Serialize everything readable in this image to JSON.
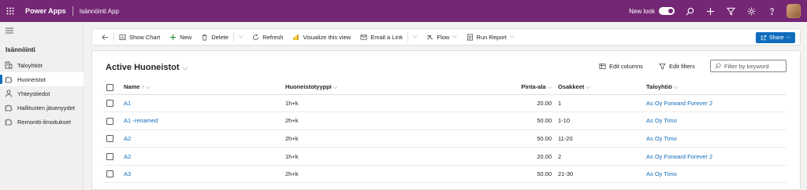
{
  "header": {
    "brand": "Power Apps",
    "app_name": "Isännöinti App",
    "new_look_label": "New look"
  },
  "sidebar": {
    "section_title": "Isännöinti",
    "items": [
      {
        "label": "Taloyhtiöt",
        "icon": "building-icon",
        "active": false
      },
      {
        "label": "Huoneistot",
        "icon": "puzzle-icon",
        "active": true
      },
      {
        "label": "Yhteystiedot",
        "icon": "person-icon",
        "active": false
      },
      {
        "label": "Hallitusten jäsenyydet",
        "icon": "puzzle-icon",
        "active": false
      },
      {
        "label": "Remontti-ilmoitukset",
        "icon": "puzzle-icon",
        "active": false
      }
    ]
  },
  "commandbar": {
    "show_chart": "Show Chart",
    "new": "New",
    "delete": "Delete",
    "refresh": "Refresh",
    "visualize": "Visualize this view",
    "email_link": "Email a Link",
    "flow": "Flow",
    "run_report": "Run Report",
    "share": "Share"
  },
  "view": {
    "title": "Active Huoneistot",
    "edit_columns": "Edit columns",
    "edit_filters": "Edit filters",
    "search_placeholder": "Filter by keyword"
  },
  "grid": {
    "columns": {
      "name": "Name",
      "name_sort": "↑",
      "type": "Huoneistotyyppi",
      "area": "Pinta-ala",
      "shares": "Osakkeet",
      "company": "Taloyhtiö"
    },
    "rows": [
      {
        "name": "A1",
        "type": "1h+k",
        "area": "20.00",
        "shares": "1",
        "company": "As Oy Forward Forever 2"
      },
      {
        "name": "A1 -renamed",
        "type": "2h+k",
        "area": "50.00",
        "shares": "1-10",
        "company": "As Oy Timo"
      },
      {
        "name": "A2",
        "type": "2h+k",
        "area": "50.00",
        "shares": "11-20",
        "company": "As Oy Timo"
      },
      {
        "name": "A2",
        "type": "1h+k",
        "area": "20.00",
        "shares": "2",
        "company": "As Oy Forward Forever 2"
      },
      {
        "name": "A3",
        "type": "2h+k",
        "area": "50.00",
        "shares": "21-30",
        "company": "As Oy Timo"
      }
    ]
  },
  "colors": {
    "topbar": "#742774",
    "accent": "#0f6cbd",
    "sidebar_bg": "#f0f0f0"
  }
}
